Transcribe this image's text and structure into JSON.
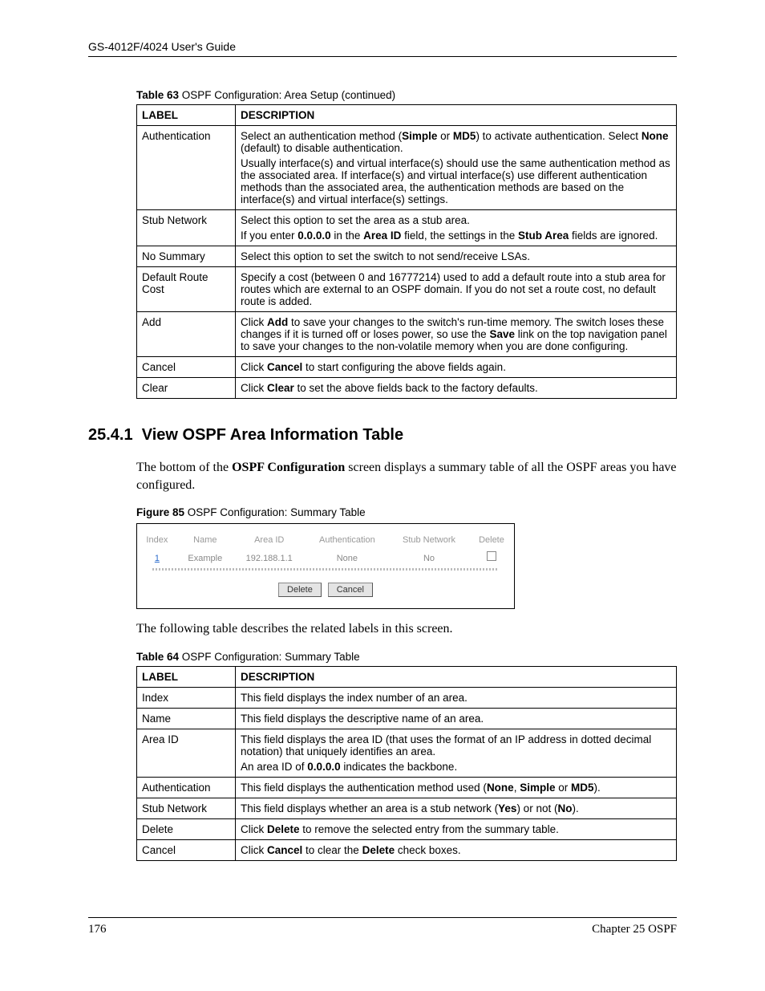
{
  "header": {
    "guide_title": "GS-4012F/4024 User's Guide"
  },
  "table63": {
    "caption_strong": "Table 63",
    "caption_rest": "   OSPF Configuration: Area Setup  (continued)",
    "col_label": "LABEL",
    "col_desc": "DESCRIPTION",
    "rows": [
      {
        "label": "Authentication",
        "desc_parts": [
          {
            "segments": [
              {
                "t": "Select an authentication method ("
              },
              {
                "t": "Simple",
                "b": true
              },
              {
                "t": " or "
              },
              {
                "t": "MD5",
                "b": true
              },
              {
                "t": ") to activate authentication. Select "
              },
              {
                "t": "None",
                "b": true
              },
              {
                "t": " (default) to disable authentication."
              }
            ]
          },
          {
            "segments": [
              {
                "t": "Usually interface(s) and virtual interface(s) should use the same authentication method as the associated area. If interface(s) and virtual interface(s) use different authentication methods than the associated area, the authentication methods are based on the interface(s) and virtual interface(s) settings."
              }
            ]
          }
        ]
      },
      {
        "label": "Stub Network",
        "desc_parts": [
          {
            "segments": [
              {
                "t": "Select this option to set the area as a stub area."
              }
            ]
          },
          {
            "segments": [
              {
                "t": "If you enter "
              },
              {
                "t": "0.0.0.0",
                "b": true
              },
              {
                "t": " in the "
              },
              {
                "t": "Area ID",
                "b": true
              },
              {
                "t": " field, the settings in the "
              },
              {
                "t": "Stub Area",
                "b": true
              },
              {
                "t": " fields are ignored."
              }
            ]
          }
        ]
      },
      {
        "label": "No Summary",
        "desc_parts": [
          {
            "segments": [
              {
                "t": "Select this option to set the switch to not send/receive LSAs."
              }
            ]
          }
        ]
      },
      {
        "label": "Default Route Cost",
        "desc_parts": [
          {
            "segments": [
              {
                "t": "Specify a cost (between 0 and 16777214) used to add a default route into a stub area for routes which are external to an OSPF domain. If you do not set a route cost, no default route is added."
              }
            ]
          }
        ]
      },
      {
        "label": "Add",
        "desc_parts": [
          {
            "segments": [
              {
                "t": "Click "
              },
              {
                "t": "Add",
                "b": true
              },
              {
                "t": " to save your changes to the switch's run-time memory. The switch loses these changes if it is turned off or loses power, so use the "
              },
              {
                "t": "Save",
                "b": true
              },
              {
                "t": " link on the top navigation panel to save your changes to the non-volatile memory when you are done configuring."
              }
            ]
          }
        ]
      },
      {
        "label": "Cancel",
        "desc_parts": [
          {
            "segments": [
              {
                "t": "Click "
              },
              {
                "t": "Cancel",
                "b": true
              },
              {
                "t": " to start configuring the above fields again."
              }
            ]
          }
        ]
      },
      {
        "label": "Clear",
        "desc_parts": [
          {
            "segments": [
              {
                "t": "Click "
              },
              {
                "t": "Clear",
                "b": true
              },
              {
                "t": " to set the above fields back to the factory defaults."
              }
            ]
          }
        ]
      }
    ]
  },
  "section": {
    "number": "25.4.1",
    "title": "View OSPF Area Information Table",
    "intro_segments": [
      {
        "t": "The bottom of the "
      },
      {
        "t": "OSPF Configuration",
        "b": true
      },
      {
        "t": " screen displays a summary table of all the OSPF areas you have configured."
      }
    ],
    "after_fig": "The following table describes the related labels in this screen."
  },
  "figure85": {
    "caption_strong": "Figure 85",
    "caption_rest": "   OSPF Configuration: Summary Table",
    "headers": [
      "Index",
      "Name",
      "Area ID",
      "Authentication",
      "Stub Network",
      "Delete"
    ],
    "row": {
      "index": "1",
      "name": "Example",
      "area_id": "192.188.1.1",
      "auth": "None",
      "stub": "No"
    },
    "buttons": {
      "delete": "Delete",
      "cancel": "Cancel"
    }
  },
  "table64": {
    "caption_strong": "Table 64",
    "caption_rest": "   OSPF Configuration: Summary Table",
    "col_label": "LABEL",
    "col_desc": "DESCRIPTION",
    "rows": [
      {
        "label": "Index",
        "desc_parts": [
          {
            "segments": [
              {
                "t": "This field displays the index number of an area."
              }
            ]
          }
        ]
      },
      {
        "label": "Name",
        "desc_parts": [
          {
            "segments": [
              {
                "t": "This field displays the descriptive name of an area."
              }
            ]
          }
        ]
      },
      {
        "label": "Area ID",
        "desc_parts": [
          {
            "segments": [
              {
                "t": "This field displays the area ID (that uses the format of an IP address in dotted decimal notation) that uniquely identifies an area."
              }
            ]
          },
          {
            "segments": [
              {
                "t": "An area ID of "
              },
              {
                "t": "0.0.0.0",
                "b": true
              },
              {
                "t": " indicates the backbone."
              }
            ]
          }
        ]
      },
      {
        "label": "Authentication",
        "desc_parts": [
          {
            "segments": [
              {
                "t": "This field displays the authentication method used ("
              },
              {
                "t": "None",
                "b": true
              },
              {
                "t": ", "
              },
              {
                "t": "Simple",
                "b": true
              },
              {
                "t": " or "
              },
              {
                "t": "MD5",
                "b": true
              },
              {
                "t": ")."
              }
            ]
          }
        ]
      },
      {
        "label": "Stub Network",
        "desc_parts": [
          {
            "segments": [
              {
                "t": "This field displays whether an area is a stub network ("
              },
              {
                "t": "Yes",
                "b": true
              },
              {
                "t": ") or not ("
              },
              {
                "t": "No",
                "b": true
              },
              {
                "t": ")."
              }
            ]
          }
        ]
      },
      {
        "label": "Delete",
        "desc_parts": [
          {
            "segments": [
              {
                "t": "Click "
              },
              {
                "t": "Delete",
                "b": true
              },
              {
                "t": " to remove the selected entry from the summary table."
              }
            ]
          }
        ]
      },
      {
        "label": "Cancel",
        "desc_parts": [
          {
            "segments": [
              {
                "t": "Click "
              },
              {
                "t": "Cancel",
                "b": true
              },
              {
                "t": " to clear the "
              },
              {
                "t": "Delete",
                "b": true
              },
              {
                "t": " check boxes."
              }
            ]
          }
        ]
      }
    ]
  },
  "footer": {
    "page": "176",
    "chapter": "Chapter 25 OSPF"
  }
}
